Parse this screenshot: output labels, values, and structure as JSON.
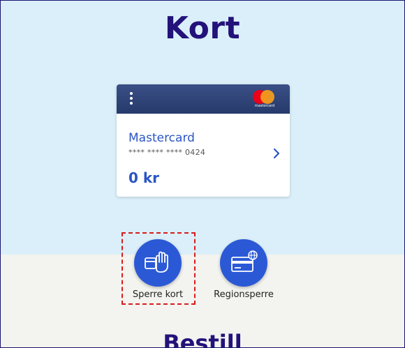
{
  "page": {
    "title": "Kort",
    "section_title": "Bestill"
  },
  "card": {
    "brand_logo_text": "mastercard",
    "name": "Mastercard",
    "number_masked": "**** **** **** 0424",
    "balance": "0 kr"
  },
  "actions": [
    {
      "label": "Sperre kort",
      "icon": "hand-stop-card-icon"
    },
    {
      "label": "Regionsperre",
      "icon": "card-globe-icon"
    }
  ],
  "colors": {
    "title": "#23127a",
    "accent": "#2b59d6",
    "link": "#2a55c4",
    "top_band": "#daeff9",
    "bottom_band": "#f3f3ef",
    "card_header": "#263a6b",
    "highlight": "#d81b1b"
  }
}
